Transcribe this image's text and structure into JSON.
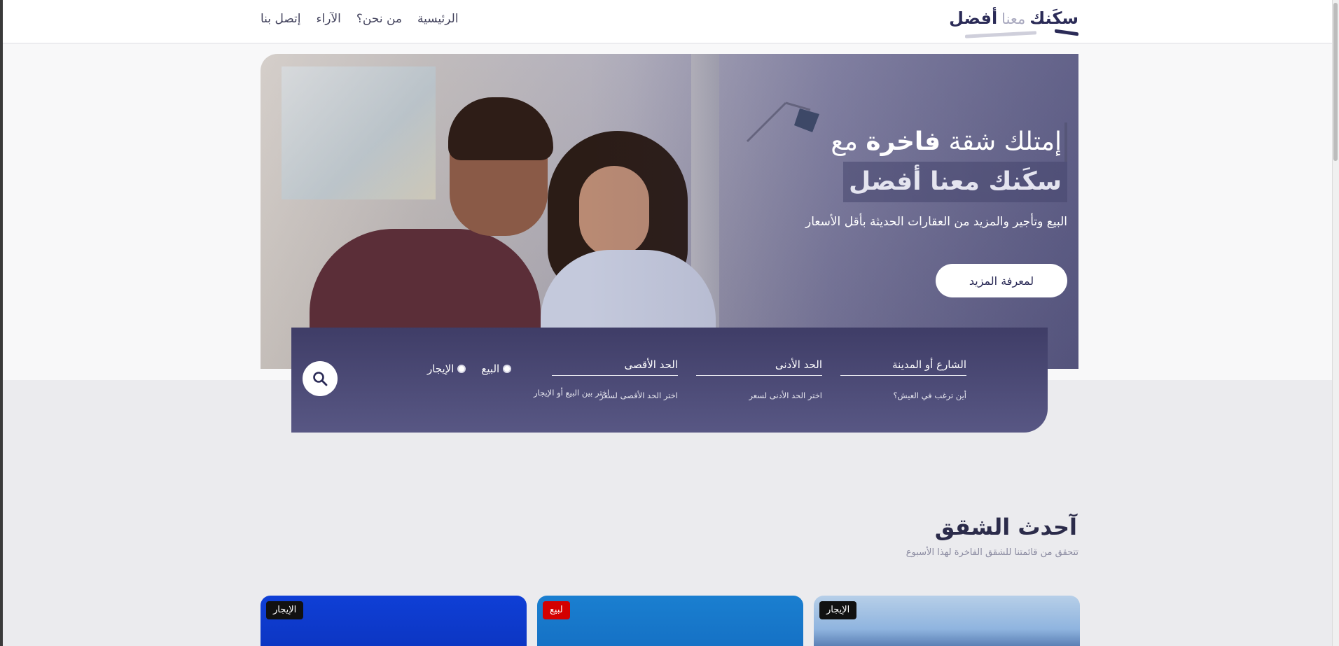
{
  "logo": {
    "word1": "سكَنك",
    "word2": "معنا",
    "word3": "أفضل"
  },
  "nav": {
    "home": "الرئيسية",
    "about": "من نحن؟",
    "reviews": "الآراء",
    "contact": "إتصل بنا"
  },
  "hero": {
    "line1_prefix": "إمتلك شقة",
    "line1_bold": "فاخرة",
    "line1_suffix": "مع",
    "line2": "سكَنك معنا أفضل",
    "subtitle": "البيع وتأجير والمزيد من العقارات الحديثة بأقل الأسعار",
    "cta": "لمعرفة المزيد"
  },
  "search": {
    "location_label": "الشارع أو المدينة",
    "location_hint": "أين ترغب في العيش؟",
    "min_label": "الحد الأدنى",
    "min_hint": "اختر الحد الأدنى لسعر",
    "max_label": "الحد الأقصى",
    "max_hint": "اختر الحد الأقصى لسعر",
    "sale_option": "البيع",
    "rent_option": "الإيجار",
    "type_hint": "اختر بين البيع أو الإيجار"
  },
  "latest": {
    "title": "آحدث الشقق",
    "subtitle": "تتحقق من قائمتنا للشقق الفاخرة لهذا الأسبوع",
    "cards": [
      {
        "badge": "الإيجار",
        "badge_color": "#111111"
      },
      {
        "badge": "لبيع",
        "badge_color": "#d40000"
      },
      {
        "badge": "الإيجار",
        "badge_color": "#111111"
      }
    ]
  },
  "colors": {
    "brand": "#2b2b57",
    "panel": "#4a4975",
    "background": "#ebebee"
  }
}
